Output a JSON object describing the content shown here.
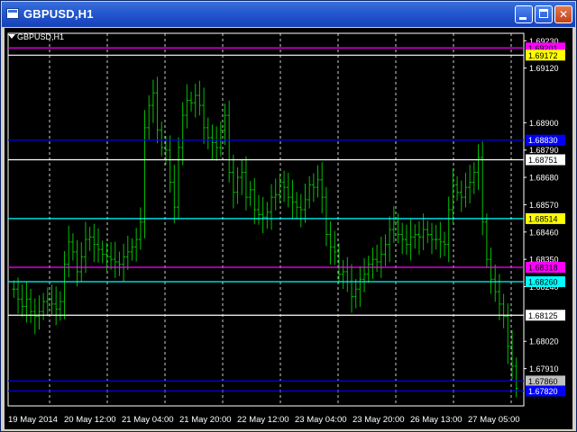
{
  "window": {
    "title": "GBPUSD,H1",
    "app_icon": "chart-window-icon",
    "minimize_icon": "minimize-icon",
    "maximize_icon": "maximize-icon",
    "close_icon": "close-icon"
  },
  "chart": {
    "symbol_label": "GBPUSD,H1",
    "dropdown_icon": "triangle-down-icon",
    "background": "#000000",
    "candle_color": "#00c000",
    "grid_color": "#ffffff",
    "axis_color": "#ffffff"
  },
  "chart_data": {
    "type": "bar",
    "subtype": "ohlc-price-chart",
    "symbol": "GBPUSD",
    "timeframe": "H1",
    "ylim": [
      1.6776,
      1.6926
    ],
    "y_ticks": [
      "1.69230",
      "1.69120",
      "1.68900",
      "1.68790",
      "1.68680",
      "1.68570",
      "1.68460",
      "1.68350",
      "1.68240",
      "1.68020",
      "1.67910"
    ],
    "x_ticks": [
      "19 May 2014",
      "20 May 12:00",
      "21 May 04:00",
      "21 May 20:00",
      "22 May 12:00",
      "23 May 04:00",
      "23 May 20:00",
      "26 May 13:00",
      "27 May 05:00"
    ],
    "grid": true,
    "horizontal_levels": [
      {
        "label": "1.69201",
        "value": 1.69201,
        "line_color": "#ff00ff",
        "tag_bg": "#ff00ff",
        "tag_fg": "#000000"
      },
      {
        "label": "1.69172",
        "value": 1.69172,
        "line_color": "#ffffff",
        "tag_bg": "#ffff00",
        "tag_fg": "#000000"
      },
      {
        "label": "1.68830",
        "value": 1.6883,
        "line_color": "#0000ff",
        "tag_bg": "#0000ff",
        "tag_fg": "#ffffff"
      },
      {
        "label": "1.68751",
        "value": 1.68751,
        "line_color": "#ffffff",
        "tag_bg": "#ffffff",
        "tag_fg": "#000000"
      },
      {
        "label": "1.68514",
        "value": 1.68514,
        "line_color": "#00ffff",
        "tag_bg": "#ffff00",
        "tag_fg": "#000000"
      },
      {
        "label": "1.68318",
        "value": 1.68318,
        "line_color": "#ff00ff",
        "tag_bg": "#ff00ff",
        "tag_fg": "#000000"
      },
      {
        "label": "1.68260",
        "value": 1.6826,
        "line_color": "#00ffff",
        "tag_bg": "#00ffff",
        "tag_fg": "#000000"
      },
      {
        "label": "1.68125",
        "value": 1.68125,
        "line_color": "#ffffff",
        "tag_bg": "#ffffff",
        "tag_fg": "#000000"
      },
      {
        "label": "1.67860",
        "value": 1.6786,
        "line_color": "#0000ff",
        "tag_bg": "#c0c0c0",
        "tag_fg": "#000000"
      },
      {
        "label": "1.67820",
        "value": 1.6782,
        "line_color": "#0000ff",
        "tag_bg": "#0000ff",
        "tag_fg": "#ffffff"
      }
    ],
    "close_series_estimate": [
      1.6823,
      1.6819,
      1.6816,
      1.6819,
      1.6814,
      1.6812,
      1.6814,
      1.6818,
      1.6819,
      1.6817,
      1.6815,
      1.6818,
      1.6833,
      1.6842,
      1.6838,
      1.683,
      1.6836,
      1.6843,
      1.6844,
      1.6841,
      1.6839,
      1.6837,
      1.6836,
      1.6835,
      1.6834,
      1.6833,
      1.6836,
      1.6838,
      1.684,
      1.6843,
      1.685,
      1.6888,
      1.6897,
      1.6902,
      1.6887,
      1.688,
      1.6879,
      1.6866,
      1.6856,
      1.688,
      1.6893,
      1.6899,
      1.6898,
      1.6901,
      1.6897,
      1.6888,
      1.6884,
      1.6882,
      1.688,
      1.6887,
      1.6893,
      1.687,
      1.6862,
      1.6868,
      1.687,
      1.686,
      1.6863,
      1.6855,
      1.6853,
      1.6852,
      1.6854,
      1.686,
      1.6861,
      1.6866,
      1.6864,
      1.686,
      1.6858,
      1.6856,
      1.6855,
      1.6859,
      1.6865,
      1.6864,
      1.6867,
      1.686,
      1.6845,
      1.684,
      1.6838,
      1.6829,
      1.683,
      1.6826,
      1.682,
      1.6823,
      1.6827,
      1.6829,
      1.6833,
      1.6835,
      1.6834,
      1.6837,
      1.6841,
      1.6847,
      1.685,
      1.6845,
      1.6843,
      1.6841,
      1.6844,
      1.6845,
      1.6844,
      1.6847,
      1.6845,
      1.6843,
      1.6843,
      1.6842,
      1.6841,
      1.6855,
      1.6865,
      1.6862,
      1.686,
      1.6864,
      1.6866,
      1.687,
      1.6876,
      1.685,
      1.6835,
      1.6827,
      1.6822,
      1.6817,
      1.6812,
      1.68,
      1.6792,
      1.6783
    ]
  }
}
